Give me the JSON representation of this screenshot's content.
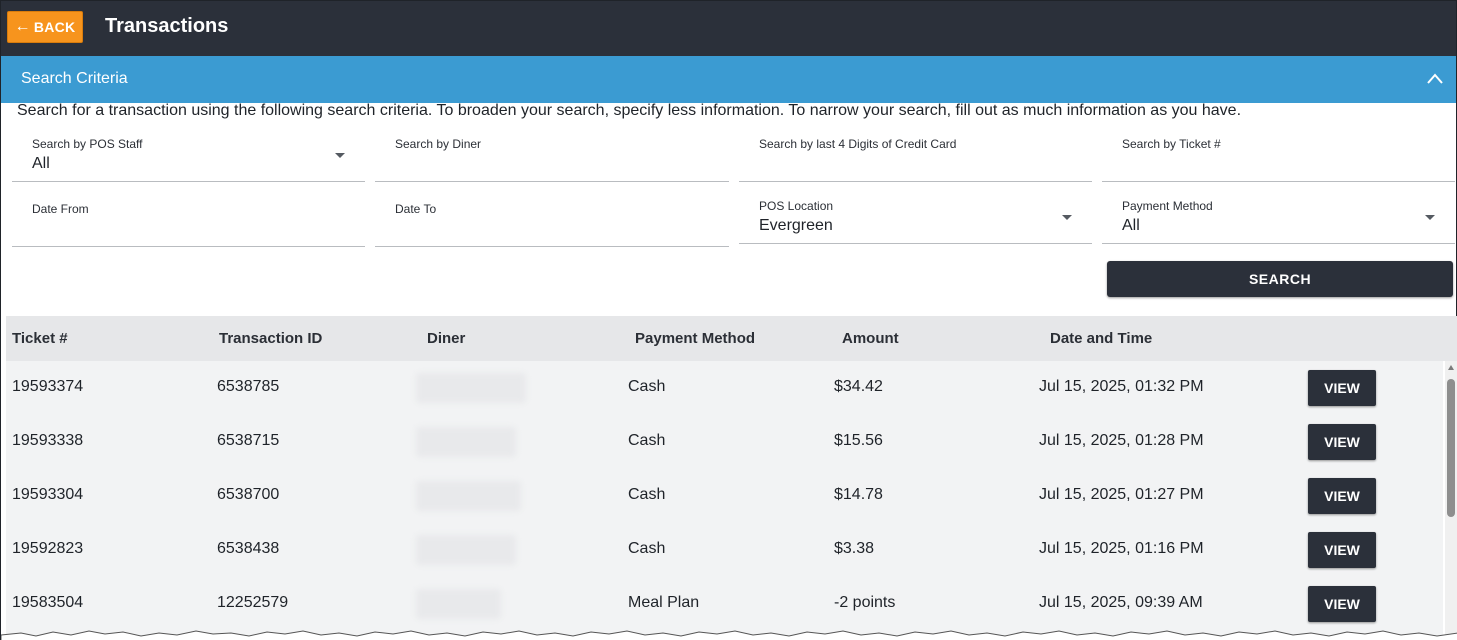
{
  "header": {
    "back_label": "BACK",
    "title": "Transactions",
    "back_icon": "arrow-left-icon"
  },
  "criteria": {
    "title": "Search Criteria",
    "collapse_icon": "chevron-up-icon",
    "help_text": "Search for a transaction using the following search criteria. To broaden your search, specify less information. To narrow your search, fill out as much information as you have.",
    "pos_staff": {
      "label": "Search by POS Staff",
      "value": "All"
    },
    "diner": {
      "label": "Search by Diner",
      "value": ""
    },
    "card_digits": {
      "label": "Search by last 4 Digits of Credit Card",
      "value": ""
    },
    "ticket": {
      "label": "Search by Ticket #",
      "value": ""
    },
    "date_from": {
      "label": "Date From",
      "value": ""
    },
    "date_to": {
      "label": "Date To",
      "value": ""
    },
    "pos_location": {
      "label": "POS Location",
      "value": "Evergreen"
    },
    "payment_method": {
      "label": "Payment Method",
      "value": "All"
    },
    "search_label": "SEARCH"
  },
  "table": {
    "columns": [
      "Ticket #",
      "Transaction ID",
      "Diner",
      "Payment Method",
      "Amount",
      "Date and Time"
    ],
    "view_label": "VIEW",
    "rows": [
      {
        "ticket": "19593374",
        "transaction_id": "6538785",
        "diner": "",
        "payment_method": "Cash",
        "amount": "$34.42",
        "datetime": "Jul 15, 2025, 01:32 PM"
      },
      {
        "ticket": "19593338",
        "transaction_id": "6538715",
        "diner": "",
        "payment_method": "Cash",
        "amount": "$15.56",
        "datetime": "Jul 15, 2025, 01:28 PM"
      },
      {
        "ticket": "19593304",
        "transaction_id": "6538700",
        "diner": "",
        "payment_method": "Cash",
        "amount": "$14.78",
        "datetime": "Jul 15, 2025, 01:27 PM"
      },
      {
        "ticket": "19592823",
        "transaction_id": "6538438",
        "diner": "",
        "payment_method": "Cash",
        "amount": "$3.38",
        "datetime": "Jul 15, 2025, 01:16 PM"
      },
      {
        "ticket": "19583504",
        "transaction_id": "12252579",
        "diner": "",
        "payment_method": "Meal Plan",
        "amount": "-2 points",
        "datetime": "Jul 15, 2025, 09:39 AM"
      }
    ]
  },
  "colors": {
    "topbar": "#2b303a",
    "accent_back": "#f7941d",
    "criteria_bar": "#3b9bd2",
    "table_header": "#e6e7e9",
    "table_body": "#f2f3f4"
  }
}
